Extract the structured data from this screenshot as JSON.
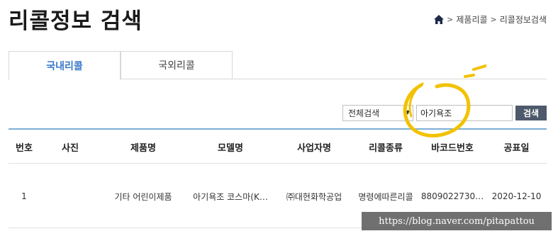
{
  "page": {
    "title": "리콜정보 검색"
  },
  "breadcrumb": {
    "home_icon": "home-icon",
    "items": [
      "제품리콜",
      "리콜정보검색"
    ],
    "separator": ">"
  },
  "tabs": [
    {
      "label": "국내리콜",
      "active": true
    },
    {
      "label": "국외리콜",
      "active": false
    }
  ],
  "search": {
    "scope": "전체검색",
    "query": "아기욕조",
    "button_label": "검색"
  },
  "table": {
    "headers": [
      "번호",
      "사진",
      "제품명",
      "모델명",
      "사업자명",
      "리콜종류",
      "바코드번호",
      "공표일"
    ],
    "rows": [
      [
        "1",
        "",
        "기타 어린이제품",
        "아기욕조 코스마(K…",
        "㈜대현화학공업",
        "명령에따른리콜",
        "8809022730…",
        "2020-12-10"
      ]
    ]
  },
  "colors": {
    "accent": "#3b78c8",
    "table_border": "#7bafd6",
    "button": "#4d5a6b",
    "highlight": "#f2c200"
  },
  "watermark": "https://blog.naver.com/pitapattou"
}
